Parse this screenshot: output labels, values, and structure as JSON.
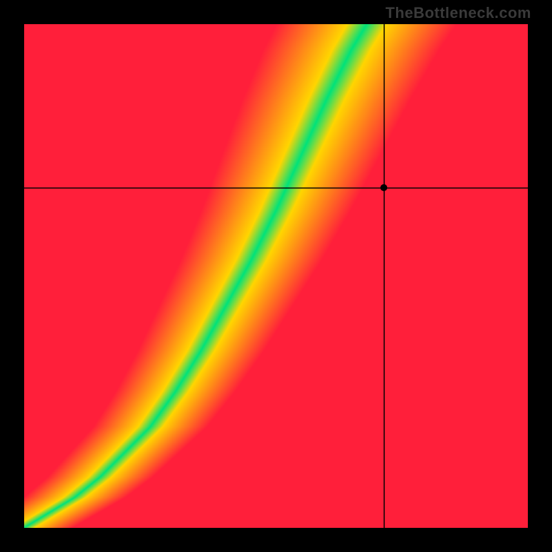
{
  "watermark": "TheBottleneck.com",
  "chart_data": {
    "type": "heatmap",
    "title": "",
    "xlabel": "",
    "ylabel": "",
    "xlim": [
      0,
      1
    ],
    "ylim": [
      0,
      1
    ],
    "crosshair": {
      "x": 0.715,
      "y": 0.675
    },
    "ridge_curve": {
      "description": "green optimal ridge path (normalized coords, origin bottom-left)",
      "points": [
        [
          0.0,
          0.0
        ],
        [
          0.05,
          0.03
        ],
        [
          0.1,
          0.06
        ],
        [
          0.15,
          0.1
        ],
        [
          0.2,
          0.15
        ],
        [
          0.25,
          0.2
        ],
        [
          0.3,
          0.27
        ],
        [
          0.35,
          0.35
        ],
        [
          0.4,
          0.44
        ],
        [
          0.45,
          0.53
        ],
        [
          0.5,
          0.63
        ],
        [
          0.55,
          0.74
        ],
        [
          0.6,
          0.85
        ],
        [
          0.65,
          0.95
        ],
        [
          0.68,
          1.0
        ]
      ]
    },
    "ridge_width": 0.06,
    "colors": {
      "far": "#ff1f3a",
      "mid": "#ffd500",
      "near": "#00e27a"
    },
    "marker": {
      "x": 0.715,
      "y": 0.675,
      "value_on_ridge": false
    }
  }
}
